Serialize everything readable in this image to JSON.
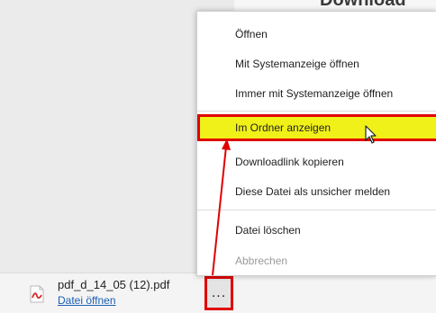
{
  "page": {
    "heading_fragment": "Download"
  },
  "context_menu": {
    "items": [
      {
        "label": "Öffnen",
        "disabled": false
      },
      {
        "label": "Mit Systemanzeige öffnen",
        "disabled": false
      },
      {
        "label": "Immer mit Systemanzeige öffnen",
        "disabled": false
      },
      {
        "label": "Im Ordner anzeigen",
        "disabled": false,
        "highlighted": true
      },
      {
        "label": "Downloadlink kopieren",
        "disabled": false
      },
      {
        "label": "Diese Datei als unsicher melden",
        "disabled": false
      },
      {
        "label": "Datei löschen",
        "disabled": false
      },
      {
        "label": "Abbrechen",
        "disabled": true
      }
    ]
  },
  "download_bar": {
    "file_name": "pdf_d_14_05 (12).pdf",
    "file_action": "Datei öffnen",
    "more_label": "...",
    "file_icon": "pdf-file-icon"
  },
  "colors": {
    "highlight": "#f1f11a",
    "annotation": "#e00000",
    "link": "#1a5fb4"
  }
}
